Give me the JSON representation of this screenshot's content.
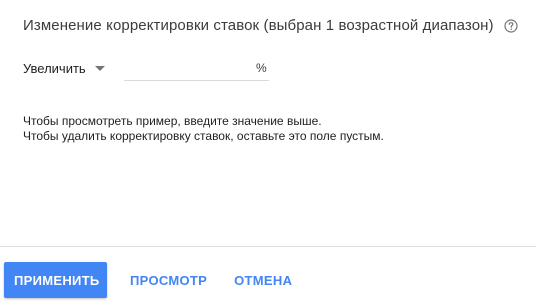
{
  "dialog": {
    "title": "Изменение корректировки ставок (выбран 1 возрастной диапазон)",
    "help_icon": "help-circle-icon"
  },
  "adjustment": {
    "direction_selected": "Увеличить",
    "value": "",
    "placeholder": "",
    "unit": "%"
  },
  "hint": {
    "line1": "Чтобы просмотреть пример, введите значение выше.",
    "line2": "Чтобы удалить корректировку ставок, оставьте это поле пустым."
  },
  "actions": {
    "apply_label": "ПРИМЕНИТЬ",
    "preview_label": "ПРОСМОТР",
    "cancel_label": "ОТМЕНА"
  },
  "colors": {
    "primary": "#4285f4",
    "divider": "#e0e0e0",
    "text": "#212121"
  }
}
